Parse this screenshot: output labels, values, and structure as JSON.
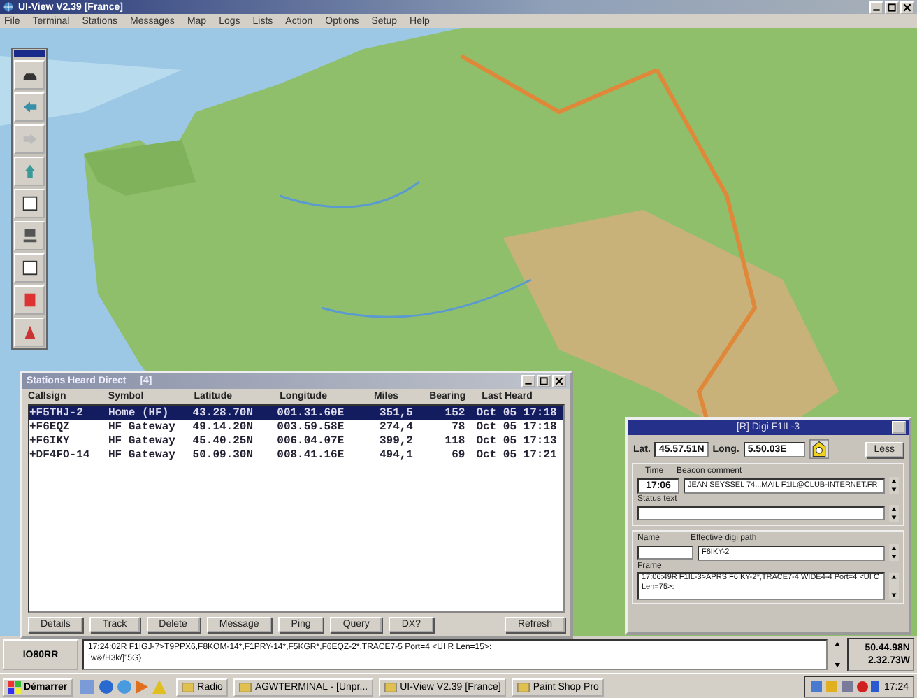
{
  "window": {
    "title": "UI-View V2.39 [France]"
  },
  "menu": [
    "File",
    "Terminal",
    "Stations",
    "Messages",
    "Map",
    "Logs",
    "Lists",
    "Action",
    "Options",
    "Setup",
    "Help"
  ],
  "stations_window": {
    "title": "Stations Heard Direct",
    "count": "[4]",
    "columns": [
      "Callsign",
      "Symbol",
      "Latitude",
      "Longitude",
      "Miles",
      "Bearing",
      "Last Heard"
    ],
    "rows": [
      {
        "selected": true,
        "cells": [
          "+F5THJ-2",
          "Home (HF)",
          "43.28.70N",
          "001.31.60E",
          "351,5",
          "152",
          "Oct 05 17:18"
        ]
      },
      {
        "selected": false,
        "cells": [
          "+F6EQZ",
          "HF Gateway",
          "49.14.20N",
          "003.59.58E",
          "274,4",
          "78",
          "Oct 05 17:18"
        ]
      },
      {
        "selected": false,
        "cells": [
          "+F6IKY",
          "HF Gateway",
          "45.40.25N",
          "006.04.07E",
          "399,2",
          "118",
          "Oct 05 17:13"
        ]
      },
      {
        "selected": false,
        "cells": [
          "+DF4FO-14",
          "HF Gateway",
          "50.09.30N",
          "008.41.16E",
          "494,1",
          "69",
          "Oct 05 17:21"
        ]
      }
    ],
    "buttons": [
      "Details",
      "Track",
      "Delete",
      "Message",
      "Ping",
      "Query",
      "DX?",
      "Refresh"
    ]
  },
  "digi_window": {
    "title": "[R] Digi F1IL-3",
    "lat_label": "Lat.",
    "lat": "45.57.51N",
    "long_label": "Long.",
    "long": "5.50.03E",
    "less_button": "Less",
    "time_label": "Time",
    "beacon_label": "Beacon comment",
    "time": "17:06",
    "beacon": "JEAN SEYSSEL 74...MAIL F1IL@CLUB-INTERNET.FR",
    "status_label": "Status text",
    "name_label": "Name",
    "path_label": "Effective digi path",
    "path": "F6IKY-2",
    "frame_label": "Frame",
    "frame": "17:06:49R F1IL-3>APRS,F6IKY-2*,TRACE7-4,WIDE4-4 Port=4 <UI C Len=75>:"
  },
  "status_bar": {
    "locator": "IO80RR",
    "lines": [
      "17:24:02R F1IGJ-7>T9PPX6,F8KOM-14*,F1PRY-14*,F5KGR*,F6EQZ-2*,TRACE7-5 Port=4 <UI R Len=15>:",
      "`w&/H3k/]\"5G}"
    ],
    "lat": "50.44.98N",
    "long": "2.32.73W"
  },
  "taskbar": {
    "start": "Démarrer",
    "tasks": [
      "Radio",
      "AGWTERMINAL - [Unpr...",
      "UI-View V2.39 [France]",
      "Paint Shop Pro"
    ],
    "clock": "17:24"
  }
}
